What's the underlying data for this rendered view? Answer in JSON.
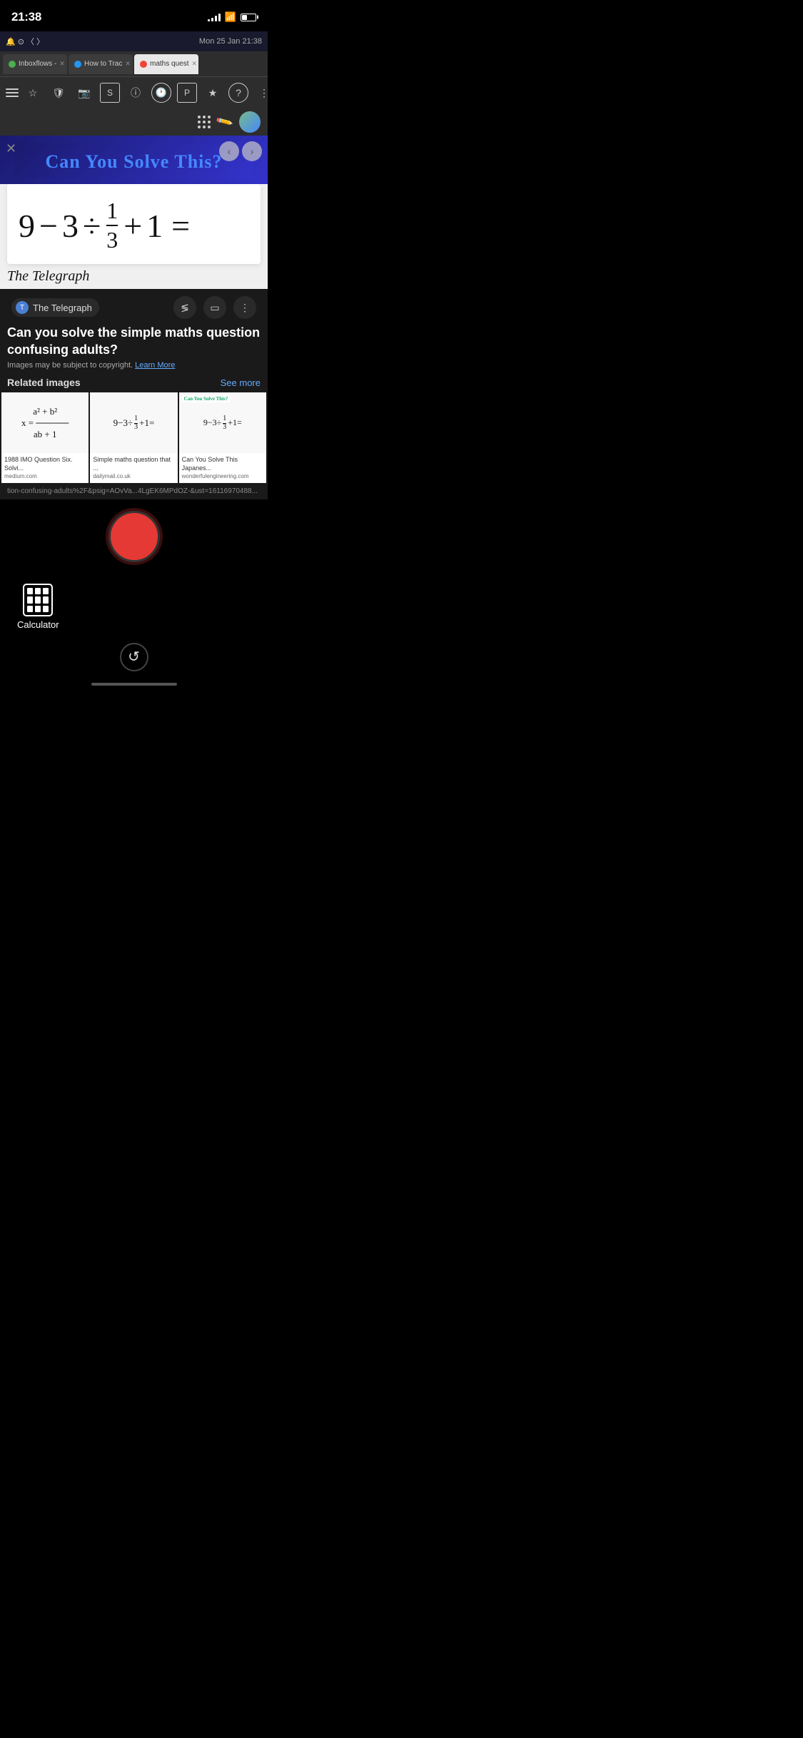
{
  "statusBar": {
    "time": "21:38",
    "date": "Mon 25 Jan 21:38"
  },
  "browserTabs": [
    {
      "label": "Inboxflows -",
      "active": false,
      "favicon": "green"
    },
    {
      "label": "How to Trac",
      "active": false,
      "favicon": "blue"
    },
    {
      "label": "maths quest",
      "active": true,
      "favicon": "red"
    }
  ],
  "puzzle": {
    "header": "Can You Solve This?",
    "equation": "9 − 3 ÷ 1/3 + 1 =",
    "source": "The Telegraph"
  },
  "imageSearch": {
    "title": "Can you solve the simple maths question confusing adults?",
    "copyright": "Images may be subject to copyright.",
    "learnMore": "Learn More",
    "relatedLabel": "Related images",
    "seeMore": "See more",
    "items": [
      {
        "math": "x = (a² + b²) / (ab + 1)",
        "caption": "1988 IMO Question Six. Solvi...",
        "source": "medium.com"
      },
      {
        "math": "9 − 3 ÷ 1/3 + 1 =",
        "caption": "Simple maths question that ...",
        "source": "dailymail.co.uk"
      },
      {
        "math": "9 − 3 ÷ 1/3 + 1 =",
        "badge": "Can You Solve This?",
        "caption": "Can You Solve This Japanes...",
        "source": "wonderfulengineering.com"
      }
    ]
  },
  "urlBar": {
    "text": "tion-confusing-adults%2F&psig=AOvVa...4LgEK6MPdOZ-&ust=16116970488..."
  },
  "tools": {
    "calculator": "Calculator",
    "undoIcon": "↺"
  },
  "sourceName": "The Telegraph",
  "shareActions": [
    "share",
    "bookmark",
    "more"
  ]
}
